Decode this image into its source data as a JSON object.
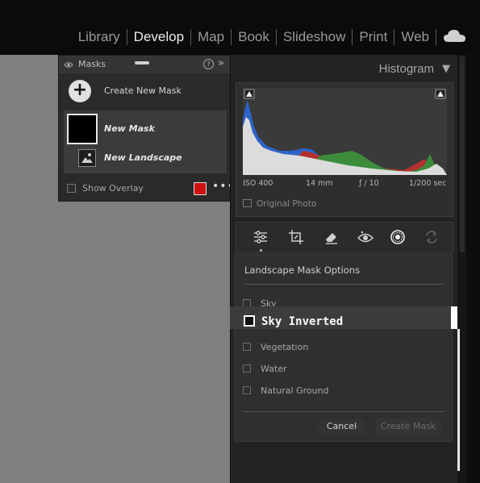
{
  "modules": [
    {
      "label": "Library",
      "active": false
    },
    {
      "label": "Develop",
      "active": true
    },
    {
      "label": "Map",
      "active": false
    },
    {
      "label": "Book",
      "active": false
    },
    {
      "label": "Slideshow",
      "active": false
    },
    {
      "label": "Print",
      "active": false
    },
    {
      "label": "Web",
      "active": false
    }
  ],
  "masks_panel": {
    "title": "Masks",
    "help_icon": "?",
    "collapse_icon": "»",
    "create_label": "Create New Mask",
    "mask_name": "New Mask",
    "component_name": "New Landscape",
    "overlay_label": "Show Overlay",
    "overlay_color": "#d01010"
  },
  "histogram": {
    "title": "Histogram",
    "iso": "ISO 400",
    "focal": "14 mm",
    "aperture": "ƒ / 10",
    "shutter": "1/200 sec",
    "original_photo_label": "Original Photo"
  },
  "landscape_options": {
    "title": "Landscape Mask Options",
    "items": [
      "Sky",
      "Vegetation",
      "Water",
      "Natural Ground"
    ],
    "selected_item": "Sky Inverted",
    "cancel_label": "Cancel",
    "create_label": "Create Mask"
  },
  "tools": [
    "sliders-icon",
    "crop-icon",
    "eraser-icon",
    "redeye-icon",
    "masking-icon",
    "rotate-icon"
  ]
}
